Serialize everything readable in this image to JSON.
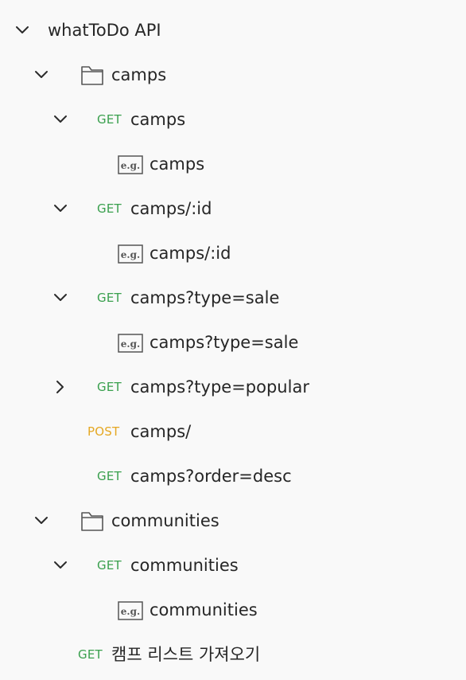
{
  "collection": {
    "name": "whatToDo API"
  },
  "folders": {
    "camps": {
      "label": "camps"
    },
    "communities": {
      "label": "communities"
    }
  },
  "requests": {
    "camps": {
      "method": "GET",
      "label": "camps",
      "example": "camps"
    },
    "camps_id": {
      "method": "GET",
      "label": "camps/:id",
      "example": "camps/:id"
    },
    "camps_sale": {
      "method": "GET",
      "label": "camps?type=sale",
      "example": "camps?type=sale"
    },
    "camps_popular": {
      "method": "GET",
      "label": "camps?type=popular"
    },
    "camps_post": {
      "method": "POST",
      "label": "camps/"
    },
    "camps_desc": {
      "method": "GET",
      "label": "camps?order=desc"
    },
    "communities": {
      "method": "GET",
      "label": "communities",
      "example": "communities"
    },
    "camp_list_kr": {
      "method": "GET",
      "label": "캠프 리스트 가져오기"
    }
  },
  "icons": {
    "chevron_down": "chevron-down-icon",
    "chevron_right": "chevron-right-icon",
    "folder": "folder-icon",
    "example": "example-icon",
    "example_text": "e.g."
  },
  "colors": {
    "get": "#3aa04e",
    "post": "#e5a823",
    "text": "#262626",
    "background": "#f9f9f9"
  }
}
